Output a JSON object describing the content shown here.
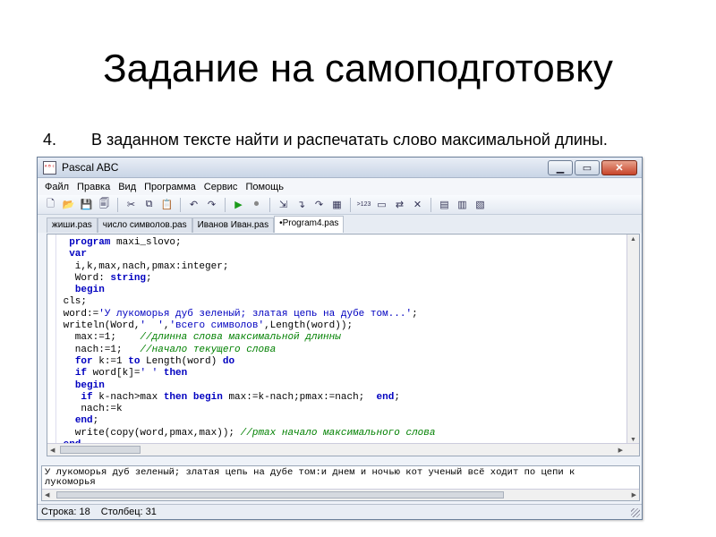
{
  "slide": {
    "title": "Задание на самоподготовку",
    "task_number": "4.",
    "task_text": "В заданном тексте найти и распечатать слово максимальной длины."
  },
  "window": {
    "title": "Pascal ABC",
    "controls": [
      "minimize-icon",
      "maximize-icon",
      "close-icon"
    ]
  },
  "menu": [
    "Файл",
    "Правка",
    "Вид",
    "Программа",
    "Сервис",
    "Помощь"
  ],
  "toolbar_icons": [
    "new-file-icon",
    "open-folder-icon",
    "save-icon",
    "save-all-icon",
    "cut-icon",
    "copy-icon",
    "paste-icon",
    "undo-icon",
    "redo-icon",
    "run-icon",
    "stop-icon",
    "step-icon",
    "step-into-icon",
    "step-over-icon",
    "watch-icon",
    "format-icon",
    "console-icon",
    "close-icon",
    "compile-icon",
    "settings-icon",
    "help-icon"
  ],
  "tabs": [
    {
      "label": "жиши.pas"
    },
    {
      "label": "число символов.pas"
    },
    {
      "label": "Иванов Иван.pas"
    },
    {
      "label": "•Program4.pas",
      "active": true
    }
  ],
  "code_lines": [
    [
      {
        "t": "  "
      },
      {
        "t": "program",
        "c": "kw"
      },
      {
        "t": " maxi_slovo;"
      }
    ],
    [
      {
        "t": "  "
      },
      {
        "t": "var",
        "c": "kw"
      }
    ],
    [
      {
        "t": "   i,k,max,nach,pmax:integer;"
      }
    ],
    [
      {
        "t": "   Word: "
      },
      {
        "t": "string",
        "c": "kw"
      },
      {
        "t": ";"
      }
    ],
    [
      {
        "t": "   "
      },
      {
        "t": "begin",
        "c": "kw"
      }
    ],
    [
      {
        "t": " cls;"
      }
    ],
    [
      {
        "t": " word:="
      },
      {
        "t": "'У лукоморья дуб зеленый; златая цепь на дубе том...'",
        "c": "str"
      },
      {
        "t": ";"
      }
    ],
    [
      {
        "t": " writeln(Word,"
      },
      {
        "t": "'  '",
        "c": "str"
      },
      {
        "t": ","
      },
      {
        "t": "'всего символов'",
        "c": "str"
      },
      {
        "t": ",Length(word));"
      }
    ],
    [
      {
        "t": "   max:=1;    "
      },
      {
        "t": "//длинна слова максимальной длинны",
        "c": "cm"
      }
    ],
    [
      {
        "t": "   nach:=1;   "
      },
      {
        "t": "//начало текущего слова",
        "c": "cm"
      }
    ],
    [
      {
        "t": "   "
      },
      {
        "t": "for",
        "c": "kw"
      },
      {
        "t": " k:=1 "
      },
      {
        "t": "to",
        "c": "kw"
      },
      {
        "t": " Length(word) "
      },
      {
        "t": "do",
        "c": "kw"
      }
    ],
    [
      {
        "t": "   "
      },
      {
        "t": "if",
        "c": "kw"
      },
      {
        "t": " word[k]="
      },
      {
        "t": "' '",
        "c": "str"
      },
      {
        "t": " "
      },
      {
        "t": "then",
        "c": "kw"
      }
    ],
    [
      {
        "t": "   "
      },
      {
        "t": "begin",
        "c": "kw"
      }
    ],
    [
      {
        "t": "    "
      },
      {
        "t": "if",
        "c": "kw"
      },
      {
        "t": " k-nach>max "
      },
      {
        "t": "then",
        "c": "kw"
      },
      {
        "t": " "
      },
      {
        "t": "begin",
        "c": "kw"
      },
      {
        "t": " max:=k-nach;pmax:=nach;  "
      },
      {
        "t": "end",
        "c": "kw"
      },
      {
        "t": ";"
      }
    ],
    [
      {
        "t": "    nach:=k"
      }
    ],
    [
      {
        "t": "   "
      },
      {
        "t": "end",
        "c": "kw"
      },
      {
        "t": ";"
      }
    ],
    [
      {
        "t": "   write(copy(word,pmax,max)); "
      },
      {
        "t": "//pmax начало максимального слова",
        "c": "cm"
      }
    ],
    [
      {
        "t": " "
      },
      {
        "t": "end.",
        "c": "kw"
      }
    ]
  ],
  "output": {
    "line1": "У лукоморья дуб зеленый; златая цепь на дубе том:и днем и ночью кот ученый всё ходит по цепи к",
    "line2": "лукоморья"
  },
  "status": {
    "line": "Строка: 18",
    "column": "Столбец: 31"
  }
}
